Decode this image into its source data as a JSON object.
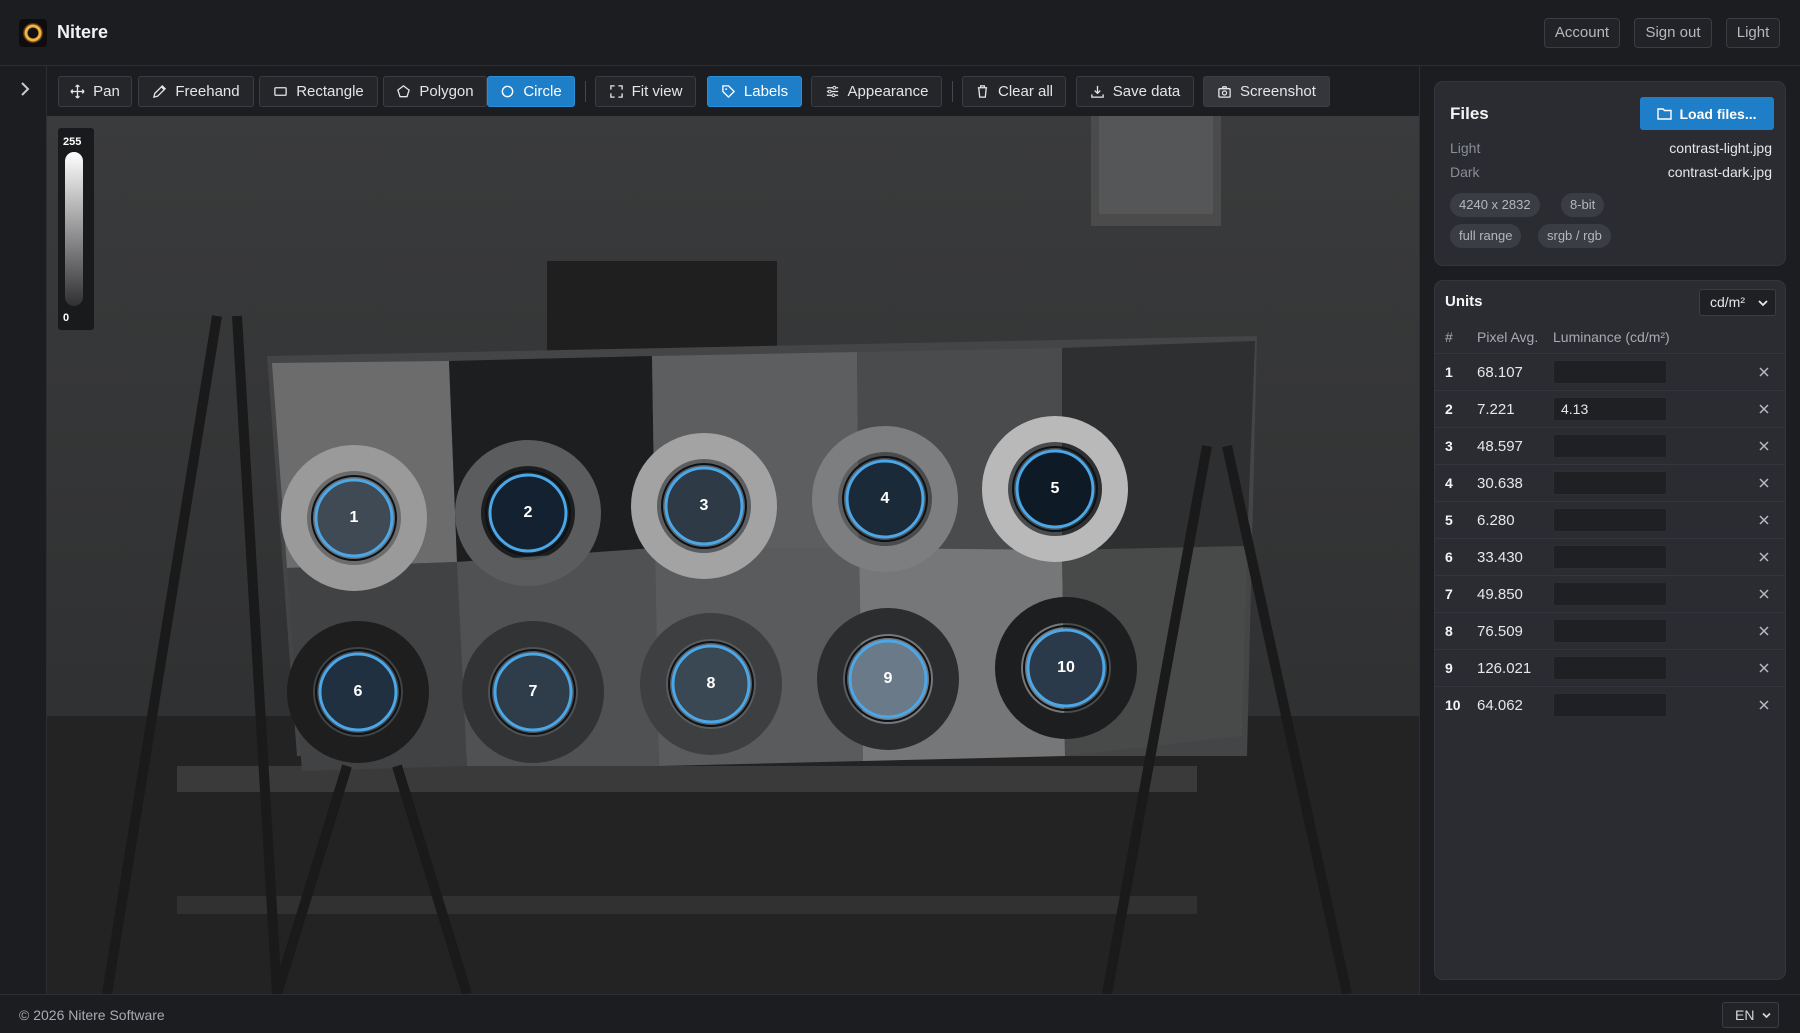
{
  "app": {
    "title": "Nitere"
  },
  "header": {
    "account": "Account",
    "sign_out": "Sign out",
    "theme": "Light"
  },
  "toolbar": {
    "pan": "Pan",
    "freehand": "Freehand",
    "rectangle": "Rectangle",
    "polygon": "Polygon",
    "circle": "Circle",
    "fit_view": "Fit view",
    "labels": "Labels",
    "appearance": "Appearance",
    "clear_all": "Clear all",
    "save_data": "Save data",
    "screenshot": "Screenshot",
    "active_tool": "Circle"
  },
  "legend": {
    "max": "255",
    "min": "0"
  },
  "rois": [
    "1",
    "2",
    "3",
    "4",
    "5",
    "6",
    "7",
    "8",
    "9",
    "10"
  ],
  "files": {
    "title": "Files",
    "load_button": "Load files...",
    "light_label": "Light",
    "light_file": "contrast-light.jpg",
    "dark_label": "Dark",
    "dark_file": "contrast-dark.jpg",
    "chips": [
      "4240 x 2832",
      "8-bit",
      "full range",
      "srgb / rgb"
    ]
  },
  "units": {
    "title": "Units",
    "selected": "cd/m²",
    "headers": {
      "index": "#",
      "pixel_avg": "Pixel Avg.",
      "luminance": "Luminance (cd/m²)"
    },
    "rows": [
      {
        "idx": "1",
        "avg": "68.107",
        "lum": ""
      },
      {
        "idx": "2",
        "avg": "7.221",
        "lum": "4.13"
      },
      {
        "idx": "3",
        "avg": "48.597",
        "lum": ""
      },
      {
        "idx": "4",
        "avg": "30.638",
        "lum": ""
      },
      {
        "idx": "5",
        "avg": "6.280",
        "lum": ""
      },
      {
        "idx": "6",
        "avg": "33.430",
        "lum": ""
      },
      {
        "idx": "7",
        "avg": "49.850",
        "lum": ""
      },
      {
        "idx": "8",
        "avg": "76.509",
        "lum": ""
      },
      {
        "idx": "9",
        "avg": "126.021",
        "lum": ""
      },
      {
        "idx": "10",
        "avg": "64.062",
        "lum": ""
      }
    ]
  },
  "footer": {
    "copyright": "© 2026 Nitere Software",
    "language": "EN"
  },
  "colors": {
    "accent": "#1e7fc8",
    "roi_stroke": "#4aa8e8",
    "background": "#1c1d20",
    "card": "#2a2c31"
  }
}
